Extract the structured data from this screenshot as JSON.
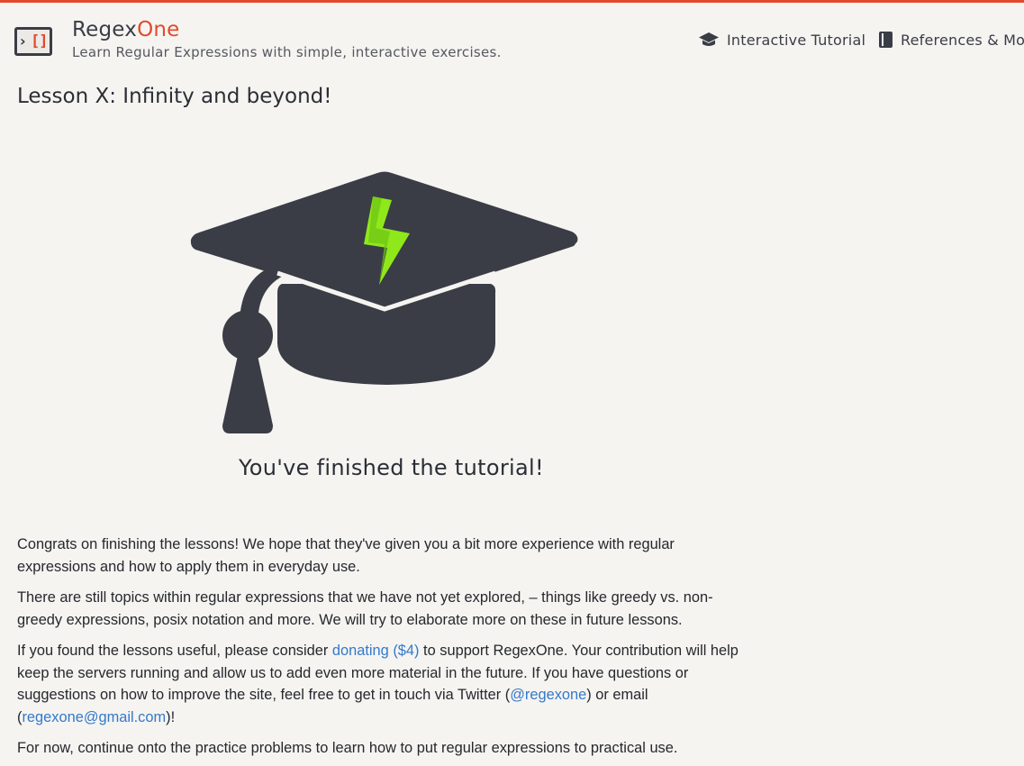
{
  "header": {
    "brand_part1": "Regex",
    "brand_part2": "One",
    "tagline": "Learn Regular Expressions with simple, interactive exercises.",
    "logo_icon": "terminal-bracket-icon",
    "nav": [
      {
        "label": "Interactive Tutorial",
        "icon": "graduation-cap-icon"
      },
      {
        "label": "References & More",
        "icon": "book-icon"
      }
    ]
  },
  "lesson": {
    "title": "Lesson X: Infinity and beyond!",
    "illustration": "graduation-cap-lightning-icon",
    "finished_text": "You've finished the tutorial!"
  },
  "content": {
    "p1": "Congrats on finishing the lessons! We hope that they've given you a bit more experience with regular expressions and how to apply them in everyday use.",
    "p2": "There are still topics within regular expressions that we have not yet explored, – things like greedy vs. non-greedy expressions, posix notation and more. We will try to elaborate more on these in future lessons.",
    "p3_before": "If you found the lessons useful, please consider ",
    "p3_link_donate": "donating ($4)",
    "p3_middle": " to support RegexOne. Your contribution will help keep the servers running and allow us to add even more material in the future. If you have questions or suggestions on how to improve the site, feel free to get in touch via Twitter (",
    "p3_link_twitter": "@regexone",
    "p3_middle2": ") or email (",
    "p3_link_email": "regexone@gmail.com",
    "p3_after": ")!",
    "p4": "For now, continue onto the practice problems to learn how to put regular expressions to practical use."
  },
  "colors": {
    "accent": "#e24a2c",
    "dark": "#3a3d46",
    "link": "#3479c9",
    "lightning": "#8fe81a",
    "background": "#f5f4f1"
  }
}
